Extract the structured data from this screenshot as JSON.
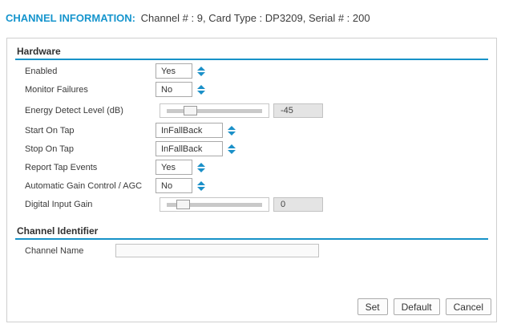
{
  "header": {
    "title": "CHANNEL INFORMATION:",
    "subtitle": "Channel # : 9, Card Type : DP3209, Serial # : 200"
  },
  "sections": {
    "hardware": {
      "title": "Hardware"
    },
    "channel_identifier": {
      "title": "Channel Identifier"
    }
  },
  "fields": {
    "enabled": {
      "label": "Enabled",
      "value": "Yes"
    },
    "monitor_failures": {
      "label": "Monitor Failures",
      "value": "No"
    },
    "energy_detect_level": {
      "label": "Energy Detect Level (dB)",
      "value": "-45",
      "slider_percent": "18"
    },
    "start_on_tap": {
      "label": "Start On Tap",
      "value": "InFallBack"
    },
    "stop_on_tap": {
      "label": "Stop On Tap",
      "value": "InFallBack"
    },
    "report_tap_events": {
      "label": "Report Tap Events",
      "value": "Yes"
    },
    "agc": {
      "label": "Automatic Gain Control / AGC",
      "value": "No"
    },
    "digital_input_gain": {
      "label": "Digital Input Gain",
      "value": "0",
      "slider_percent": "10"
    },
    "channel_name": {
      "label": "Channel Name",
      "value": ""
    }
  },
  "buttons": {
    "set": "Set",
    "default": "Default",
    "cancel": "Cancel"
  },
  "colors": {
    "accent_blue": "#1792c8",
    "header_blue": "#1695cd",
    "label_text": "#3a3a3a",
    "panel_border": "#cfcfcf",
    "value_box_bg": "#e4e4e4"
  }
}
